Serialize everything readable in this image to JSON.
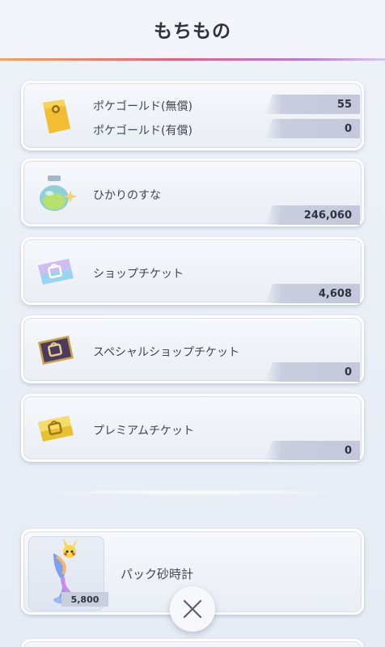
{
  "header": {
    "title": "もちもの"
  },
  "items": [
    {
      "rows": [
        {
          "label": "ポケゴールド(無償)",
          "value": "55"
        },
        {
          "label": "ポケゴールド(有償)",
          "value": "0"
        }
      ],
      "icon": "gold-bar-icon"
    },
    {
      "label": "ひかりのすな",
      "value": "246,060",
      "icon": "stardust-bottle-icon"
    },
    {
      "label": "ショップチケット",
      "value": "4,608",
      "icon": "shop-ticket-icon"
    },
    {
      "label": "スペシャルショップチケット",
      "value": "0",
      "icon": "special-shop-ticket-icon"
    },
    {
      "label": "プレミアムチケット",
      "value": "0",
      "icon": "premium-ticket-icon"
    }
  ],
  "hourglass": {
    "label": "パック砂時計",
    "count": "5,800",
    "icon": "pack-hourglass-icon"
  },
  "close": {
    "icon": "close-icon"
  }
}
